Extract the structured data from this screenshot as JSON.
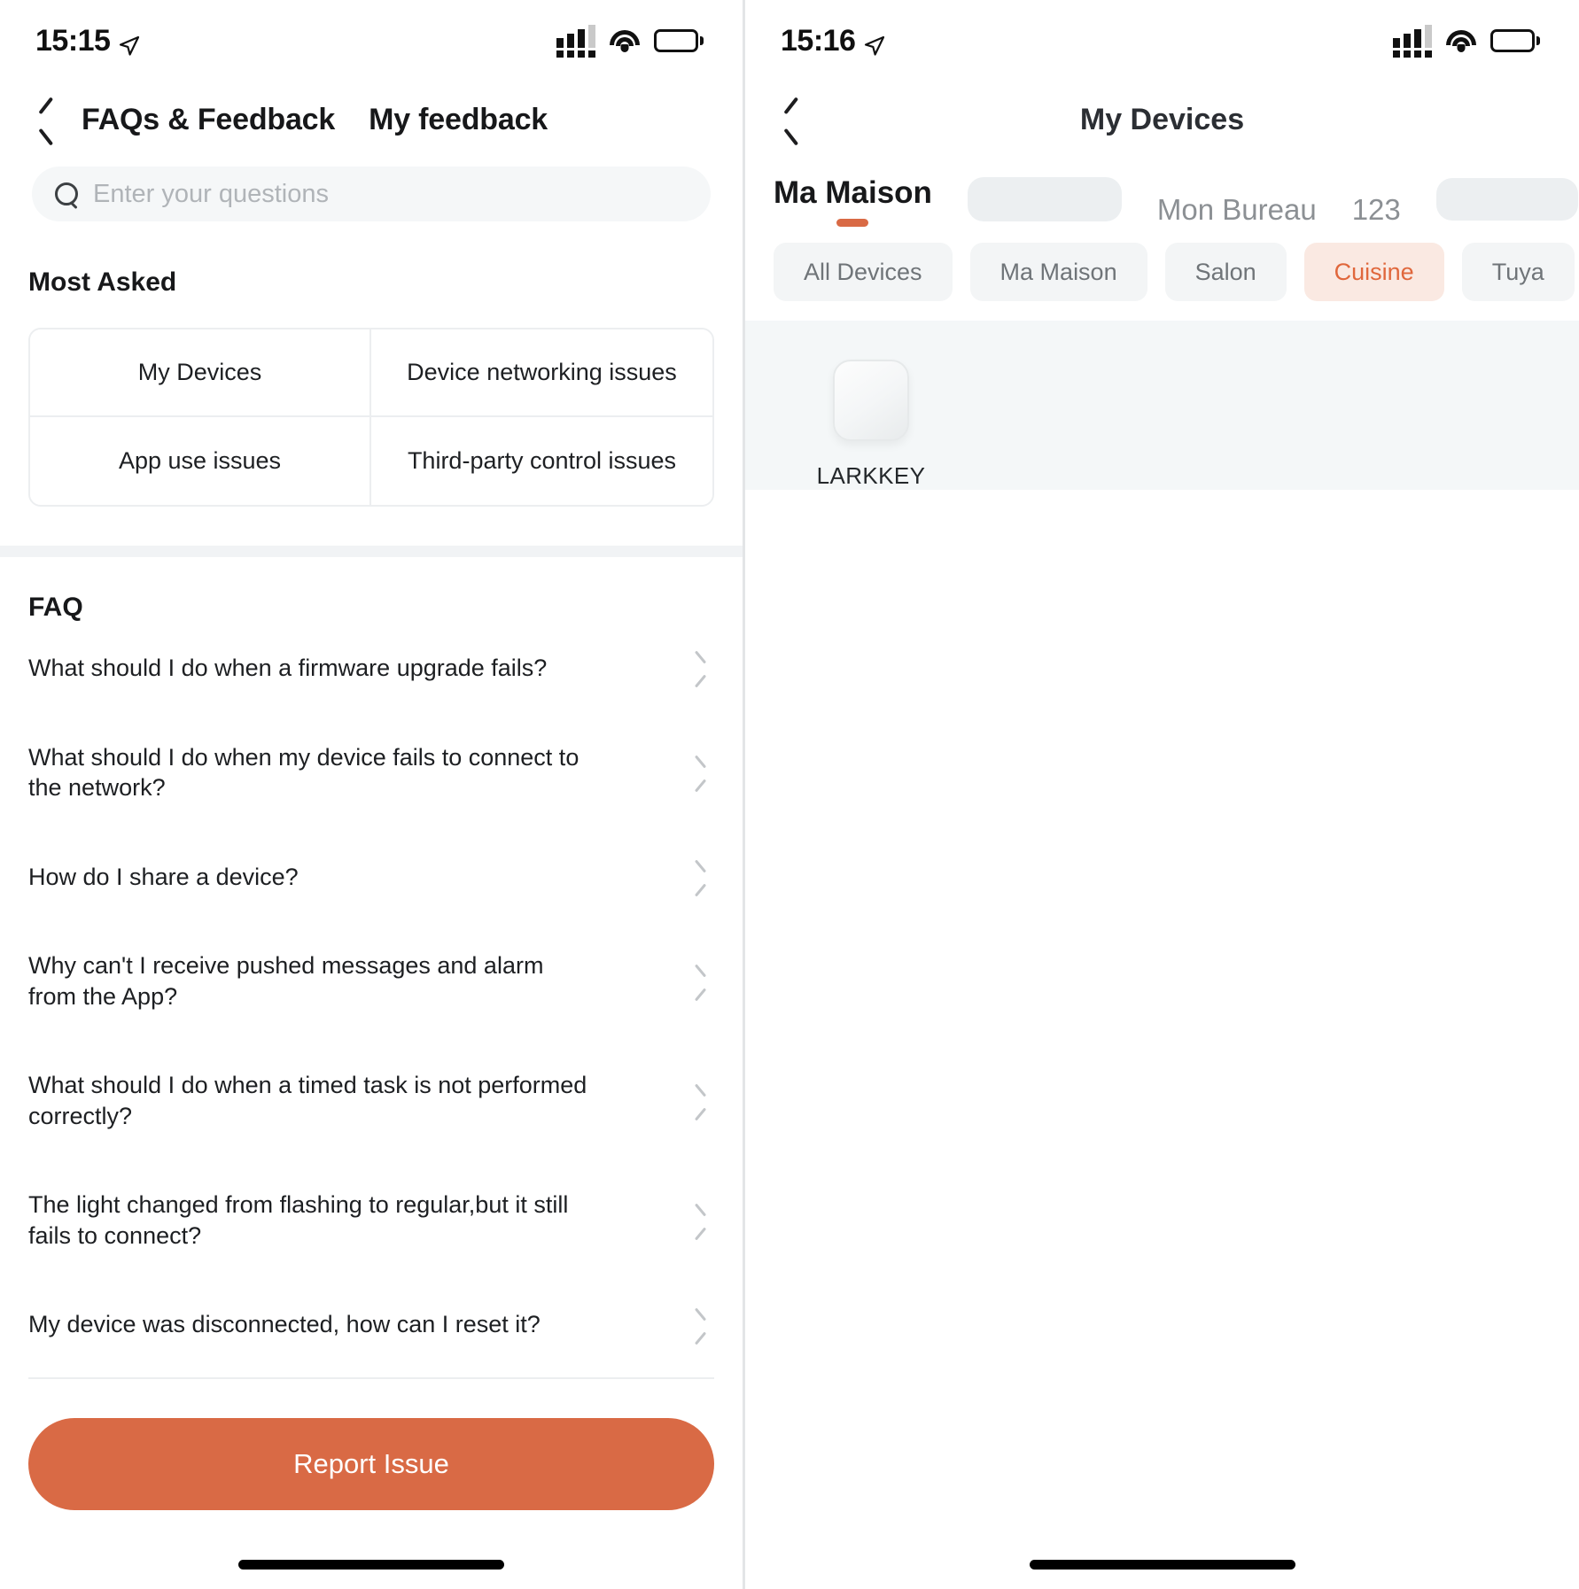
{
  "left_screen": {
    "status_bar": {
      "time": "15:15",
      "location_icon": "location-arrow-icon",
      "signal_icon": "cellular-signal-icon",
      "wifi_icon": "wifi-icon",
      "battery_icon": "battery-full-icon"
    },
    "nav": {
      "back_icon": "chevron-left-icon",
      "title": "FAQs & Feedback",
      "secondary_tab": "My feedback"
    },
    "search": {
      "icon": "search-icon",
      "placeholder": "Enter your questions",
      "value": ""
    },
    "most_asked": {
      "heading": "Most Asked",
      "items": [
        "My Devices",
        "Device networking issues",
        "App use issues",
        "Third-party control issues"
      ]
    },
    "faq": {
      "heading": "FAQ",
      "items": [
        "What should I do when a firmware upgrade fails?",
        "What should I do when my device fails to connect to the network?",
        "How do I share a device?",
        "Why can't I receive pushed messages and alarm from the App?",
        "What should I do when a timed task is not performed correctly?",
        "The light changed from flashing to regular,but it still fails to connect?",
        "My device was disconnected,  how can I reset it?"
      ],
      "chevron_icon": "chevron-right-icon"
    },
    "report_button": "Report Issue",
    "home_indicator": "home-indicator"
  },
  "right_screen": {
    "status_bar": {
      "time": "15:16",
      "location_icon": "location-arrow-icon",
      "signal_icon": "cellular-signal-icon",
      "wifi_icon": "wifi-icon",
      "battery_icon": "battery-full-icon"
    },
    "nav": {
      "back_icon": "chevron-left-icon",
      "title": "My Devices"
    },
    "home_tabs": [
      {
        "label": "Ma Maison",
        "active": true,
        "redacted": false
      },
      {
        "label": "",
        "active": false,
        "redacted": true
      },
      {
        "label": "Mon Bureau",
        "active": false,
        "redacted": false
      },
      {
        "label": "123",
        "active": false,
        "redacted": false
      },
      {
        "label": "",
        "active": false,
        "redacted": true
      }
    ],
    "room_chips": [
      {
        "label": "All Devices",
        "active": false
      },
      {
        "label": "Ma Maison",
        "active": false
      },
      {
        "label": "Salon",
        "active": false
      },
      {
        "label": "Cuisine",
        "active": true
      },
      {
        "label": "Tuya",
        "active": false
      }
    ],
    "devices": [
      {
        "name": "LARKKEY",
        "icon": "smart-switch-panel-icon"
      }
    ],
    "home_indicator": "home-indicator"
  },
  "colors": {
    "accent_orange": "#d96a45",
    "chip_active_bg": "#fae9e2",
    "chip_active_text": "#e0673c",
    "chip_bg": "#f3f5f6",
    "page_bg": "#ffffff",
    "device_area_bg": "#f4f7f8",
    "border": "#eceef0"
  }
}
